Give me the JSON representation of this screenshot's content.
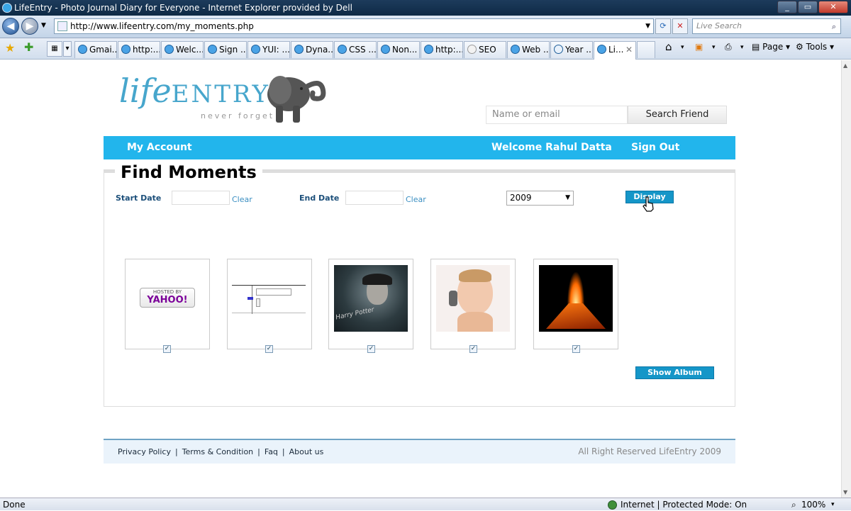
{
  "window": {
    "title": "LifeEntry - Photo Journal Diary for Everyone - Internet Explorer provided by Dell",
    "controls": [
      "_",
      "▭",
      "✕"
    ]
  },
  "browser": {
    "url": "http://www.lifeentry.com/my_moments.php",
    "search_placeholder": "Live Search",
    "tabs": [
      "Gmai...",
      "http:...",
      "Welc...",
      "Sign ...",
      "YUI: ...",
      "Dyna...",
      "CSS ...",
      "Non...",
      "http:...",
      "SEO",
      "Web ...",
      "Year ...",
      "Li..."
    ],
    "tools": [
      "Page ▾",
      "Tools ▾"
    ]
  },
  "site": {
    "logo_life": "life",
    "logo_entry": "ENTRY",
    "tagline": "never forget",
    "friend_placeholder": "Name or email",
    "friend_button": "Search Friend",
    "nav": {
      "account": "My Account",
      "welcome": "Welcome Rahul Datta",
      "signout": "Sign Out"
    },
    "section_title": "Find Moments",
    "filters": {
      "start_label": "Start Date",
      "end_label": "End Date",
      "clear": "Clear",
      "year": "2009",
      "display_button": "Display"
    },
    "thumbnails": [
      {
        "kind": "yahoo",
        "label": "HOSTED BY",
        "brand": "YAHOO!",
        "checked": true
      },
      {
        "kind": "screenshot",
        "checked": true
      },
      {
        "kind": "dark-portrait",
        "caption": "Harry Potter",
        "checked": true
      },
      {
        "kind": "child-phone",
        "checked": true
      },
      {
        "kind": "volcano",
        "checked": true
      }
    ],
    "show_album_button": "Show Album",
    "footer": {
      "links": [
        "Privacy Policy",
        "Terms & Condition",
        "Faq",
        "About us"
      ],
      "copyright": "All Right Reserved LifeEntry 2009"
    }
  },
  "status": {
    "left": "Done",
    "zone": "Internet | Protected Mode: On",
    "zoom": "100%"
  },
  "colors": {
    "nav_bar": "#22b5ec",
    "button_blue": "#1596c8",
    "logo": "#47a6cc"
  }
}
